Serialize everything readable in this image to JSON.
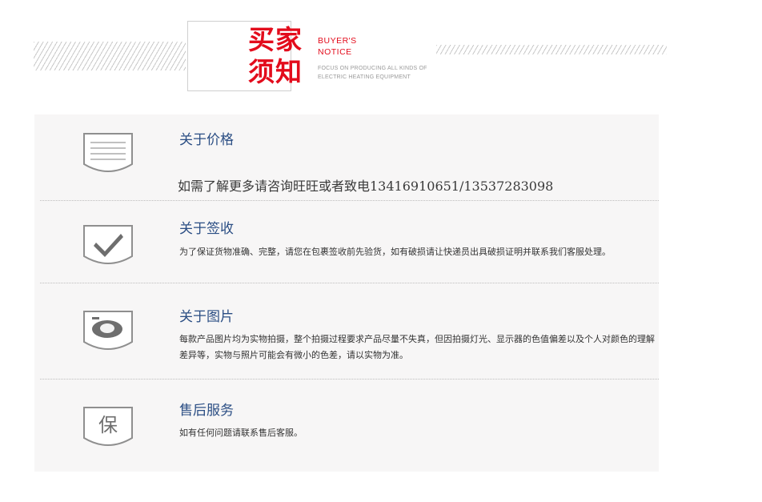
{
  "header": {
    "title_cn_line1": "买家",
    "title_cn_line2": "须知",
    "title_en_line1": "BUYER'S",
    "title_en_line2": "NOTICE",
    "subtitle_line1": "FOCUS ON PRODUCING ALL KINDS OF",
    "subtitle_line2": "ELECTRIC HEATING EQUIPMENT"
  },
  "sections": [
    {
      "icon": "document-icon",
      "heading": "关于价格",
      "text": "如需了解更多请咨询旺旺或者致电13416910651/13537283098"
    },
    {
      "icon": "checkmark-icon",
      "heading": "关于签收",
      "text": "为了保证货物准确、完整，请您在包裹签收前先验货，如有破损请让快递员出具破损证明并联系我们客服处理。"
    },
    {
      "icon": "camera-icon",
      "heading": "关于图片",
      "text": "每款产品图片均为实物拍摄，整个拍摄过程要求产品尽量不失真，但因拍摄灯光、显示器的色值偏差以及个人对颜色的理解差异等，实物与照片可能会有微小的色差，请以实物为准。"
    },
    {
      "icon": "guarantee-icon",
      "icon_char": "保",
      "heading": "售后服务",
      "text": "如有任何问题请联系售后客服。"
    }
  ],
  "colors": {
    "accent_red": "#e30c1c",
    "heading_blue": "#2b4e84",
    "panel_bg": "#f7f6f6"
  }
}
